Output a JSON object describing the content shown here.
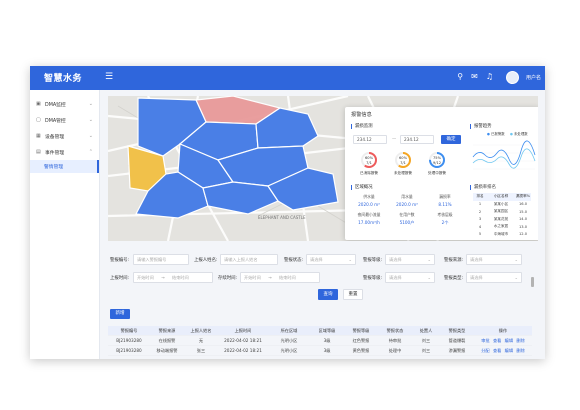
{
  "app": {
    "title": "智慧水务",
    "menu_icon": "menu-icon",
    "icons": [
      "search-icon",
      "message-icon",
      "bell-icon"
    ],
    "user_name": "用户名"
  },
  "sidebar": {
    "items": [
      {
        "label": "DMA监控",
        "icon": "monitor-icon",
        "expanded": false
      },
      {
        "label": "DMA管控",
        "icon": "control-icon",
        "expanded": false
      },
      {
        "label": "设备管理",
        "icon": "device-icon",
        "expanded": false
      },
      {
        "label": "事件管理",
        "icon": "event-icon",
        "expanded": true
      }
    ],
    "active_sub": "警情管理"
  },
  "alarm_panel": {
    "title": "报警信息",
    "time_range_title": "漏损监测",
    "date_start": "234.12",
    "date_sep": "—",
    "date_end": "234.12",
    "confirm_label": "确定",
    "rings": [
      {
        "label": "已消除报警",
        "percent": "60%",
        "sub": "7/1",
        "color": "#ee5b5b"
      },
      {
        "label": "未处理报警",
        "percent": "60%",
        "sub": "7/1",
        "color": "#f5a623"
      },
      {
        "label": "处理中报警",
        "percent": "75%",
        "sub": "9/12",
        "color": "#3d8ef0"
      }
    ],
    "trend_title": "报警趋势",
    "trend_legend": [
      "已报警数",
      "未处理数"
    ],
    "region_title": "区域概况",
    "stats": [
      {
        "label": "供水量",
        "value": "2020.0 m³"
      },
      {
        "label": "用水量",
        "value": "2020.0 m³"
      },
      {
        "label": "漏损率",
        "value": "8.11%"
      },
      {
        "label": "夜间最小流量",
        "value": "17.00m³/h"
      },
      {
        "label": "在用户数",
        "value": "5100户"
      },
      {
        "label": "考核层级",
        "value": "2个"
      }
    ],
    "rank_title": "漏损率排名",
    "rank_headers": [
      "排名",
      "小区名称",
      "漏损率%"
    ],
    "rank_rows": [
      [
        "1",
        "某某小区",
        "16.0"
      ],
      [
        "2",
        "某某园区",
        "15.0"
      ],
      [
        "3",
        "某某花苑",
        "14.0"
      ],
      [
        "4",
        "水之家居",
        "13.0"
      ],
      [
        "5",
        "中海城市",
        "12.0"
      ]
    ]
  },
  "filters": {
    "row1": [
      {
        "label": "警报编号:",
        "placeholder": "请输入警报编号"
      },
      {
        "label": "上报人姓名:",
        "placeholder": "请输入上报人姓名"
      },
      {
        "label": "警报状态:",
        "placeholder": "请选择"
      },
      {
        "label": "警报等级:",
        "placeholder": "请选择"
      },
      {
        "label": "警报来源:",
        "placeholder": "请选择"
      }
    ],
    "row2": [
      {
        "label": "上报时间:",
        "start": "开始时间",
        "end": "结束时间"
      },
      {
        "label": "存续时间:",
        "start": "开始时间",
        "end": "结束时间"
      },
      {
        "label": "警报等级:",
        "placeholder": "请选择"
      },
      {
        "label": "警报类型:",
        "placeholder": "请选择"
      }
    ],
    "query_label": "查询",
    "reset_label": "重置"
  },
  "table": {
    "new_label": "新增",
    "headers": [
      "警报编号",
      "警报来源",
      "上报人姓名",
      "上报时间",
      "所在区域",
      "区域等级",
      "警报等级",
      "警报状态",
      "处置人",
      "警报类型",
      "操作"
    ],
    "rows": [
      [
        "BJ21903280",
        "在线报警",
        "无",
        "2022-04-02 18:21",
        "光明小区",
        "3级",
        "红色警报",
        "待审批",
        "刘三",
        "管道爆裂",
        [
          "审批",
          "查看",
          "编辑",
          "删除"
        ]
      ],
      [
        "BJ21903280",
        "移动端报警",
        "张三",
        "2022-04-02 18:21",
        "光明小区",
        "3级",
        "黄色警报",
        "处理中",
        "刘三",
        "渗漏警报",
        [
          "分配",
          "查看",
          "编辑",
          "删除"
        ]
      ]
    ]
  },
  "colors": {
    "primary": "#2f66dc",
    "region_blue": "#4a7fe6",
    "region_red": "#e99494",
    "region_yellow": "#f1c14a"
  },
  "map": {
    "place_label": "ELEPHANT AND CASTLE"
  }
}
